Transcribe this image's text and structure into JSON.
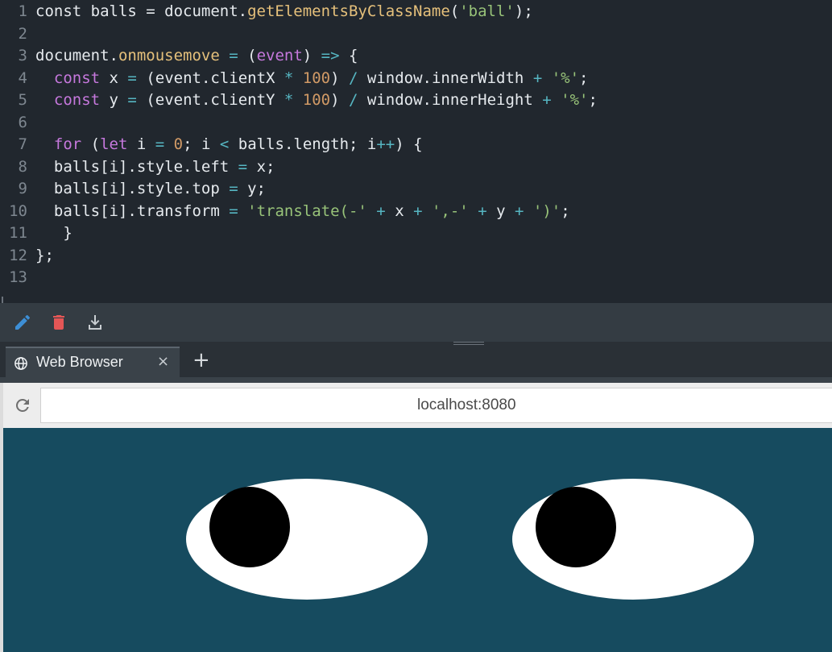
{
  "editor": {
    "line_numbers": [
      "1",
      "2",
      "3",
      "4",
      "5",
      "6",
      "7",
      "8",
      "9",
      "10",
      "11",
      "12",
      "13"
    ],
    "lines": [
      [
        [
          "pl",
          "const balls = document."
        ],
        [
          "fn",
          "getElementsByClassName"
        ],
        [
          "pl",
          "("
        ],
        [
          "str",
          "'ball'"
        ],
        [
          "pl",
          ");"
        ]
      ],
      [],
      [
        [
          "pl",
          "document."
        ],
        [
          "fn",
          "onmousemove"
        ],
        [
          "op",
          " = "
        ],
        [
          "pl",
          "("
        ],
        [
          "param",
          "event"
        ],
        [
          "pl",
          ") "
        ],
        [
          "op",
          "=>"
        ],
        [
          "pl",
          " {"
        ]
      ],
      [
        [
          "pl",
          "  "
        ],
        [
          "kw",
          "const"
        ],
        [
          "pl",
          " x "
        ],
        [
          "op",
          "="
        ],
        [
          "pl",
          " (event.clientX "
        ],
        [
          "op",
          "*"
        ],
        [
          "num",
          " 100"
        ],
        [
          "pl",
          ") "
        ],
        [
          "op",
          "/"
        ],
        [
          "pl",
          " window.innerWidth "
        ],
        [
          "op",
          "+"
        ],
        [
          "pl",
          " "
        ],
        [
          "str",
          "'%'"
        ],
        [
          "pl",
          ";"
        ]
      ],
      [
        [
          "pl",
          "  "
        ],
        [
          "kw",
          "const"
        ],
        [
          "pl",
          " y "
        ],
        [
          "op",
          "="
        ],
        [
          "pl",
          " (event.clientY "
        ],
        [
          "op",
          "*"
        ],
        [
          "num",
          " 100"
        ],
        [
          "pl",
          ") "
        ],
        [
          "op",
          "/"
        ],
        [
          "pl",
          " window.innerHeight "
        ],
        [
          "op",
          "+"
        ],
        [
          "pl",
          " "
        ],
        [
          "str",
          "'%'"
        ],
        [
          "pl",
          ";"
        ]
      ],
      [],
      [
        [
          "pl",
          "  "
        ],
        [
          "kw",
          "for"
        ],
        [
          "pl",
          " ("
        ],
        [
          "kw",
          "let"
        ],
        [
          "pl",
          " i "
        ],
        [
          "op",
          "="
        ],
        [
          "num",
          " 0"
        ],
        [
          "pl",
          "; i "
        ],
        [
          "op",
          "<"
        ],
        [
          "pl",
          " balls.length; i"
        ],
        [
          "op",
          "++"
        ],
        [
          "pl",
          ") {"
        ]
      ],
      [
        [
          "pl",
          "  balls[i].style.left "
        ],
        [
          "op",
          "="
        ],
        [
          "pl",
          " x;"
        ]
      ],
      [
        [
          "pl",
          "  balls[i].style.top "
        ],
        [
          "op",
          "="
        ],
        [
          "pl",
          " y;"
        ]
      ],
      [
        [
          "pl",
          "  balls[i].transform "
        ],
        [
          "op",
          "="
        ],
        [
          "pl",
          " "
        ],
        [
          "str",
          "'translate(-'"
        ],
        [
          "pl",
          " "
        ],
        [
          "op",
          "+"
        ],
        [
          "pl",
          " x "
        ],
        [
          "op",
          "+"
        ],
        [
          "pl",
          " "
        ],
        [
          "str",
          "',-'"
        ],
        [
          "pl",
          " "
        ],
        [
          "op",
          "+"
        ],
        [
          "pl",
          " y "
        ],
        [
          "op",
          "+"
        ],
        [
          "pl",
          " "
        ],
        [
          "str",
          "')'"
        ],
        [
          "pl",
          ";"
        ]
      ],
      [
        [
          "pl",
          "   }"
        ]
      ],
      [
        [
          "pl",
          "};"
        ]
      ],
      []
    ]
  },
  "toolbar": {
    "edit_icon": "pencil-icon",
    "delete_icon": "trash-icon",
    "download_icon": "download-icon",
    "edit_color": "#3d8fd6",
    "delete_color": "#e45656",
    "download_color": "#c9ced2"
  },
  "browser": {
    "tab_label": "Web Browser",
    "tab_icon": "globe-icon",
    "close_glyph": "×",
    "new_tab_glyph": "+",
    "reload_icon": "reload-icon",
    "url": "localhost:8080"
  },
  "page": {
    "background_color": "#164b5f",
    "eye_color": "#ffffff",
    "ball_color": "#000000"
  }
}
